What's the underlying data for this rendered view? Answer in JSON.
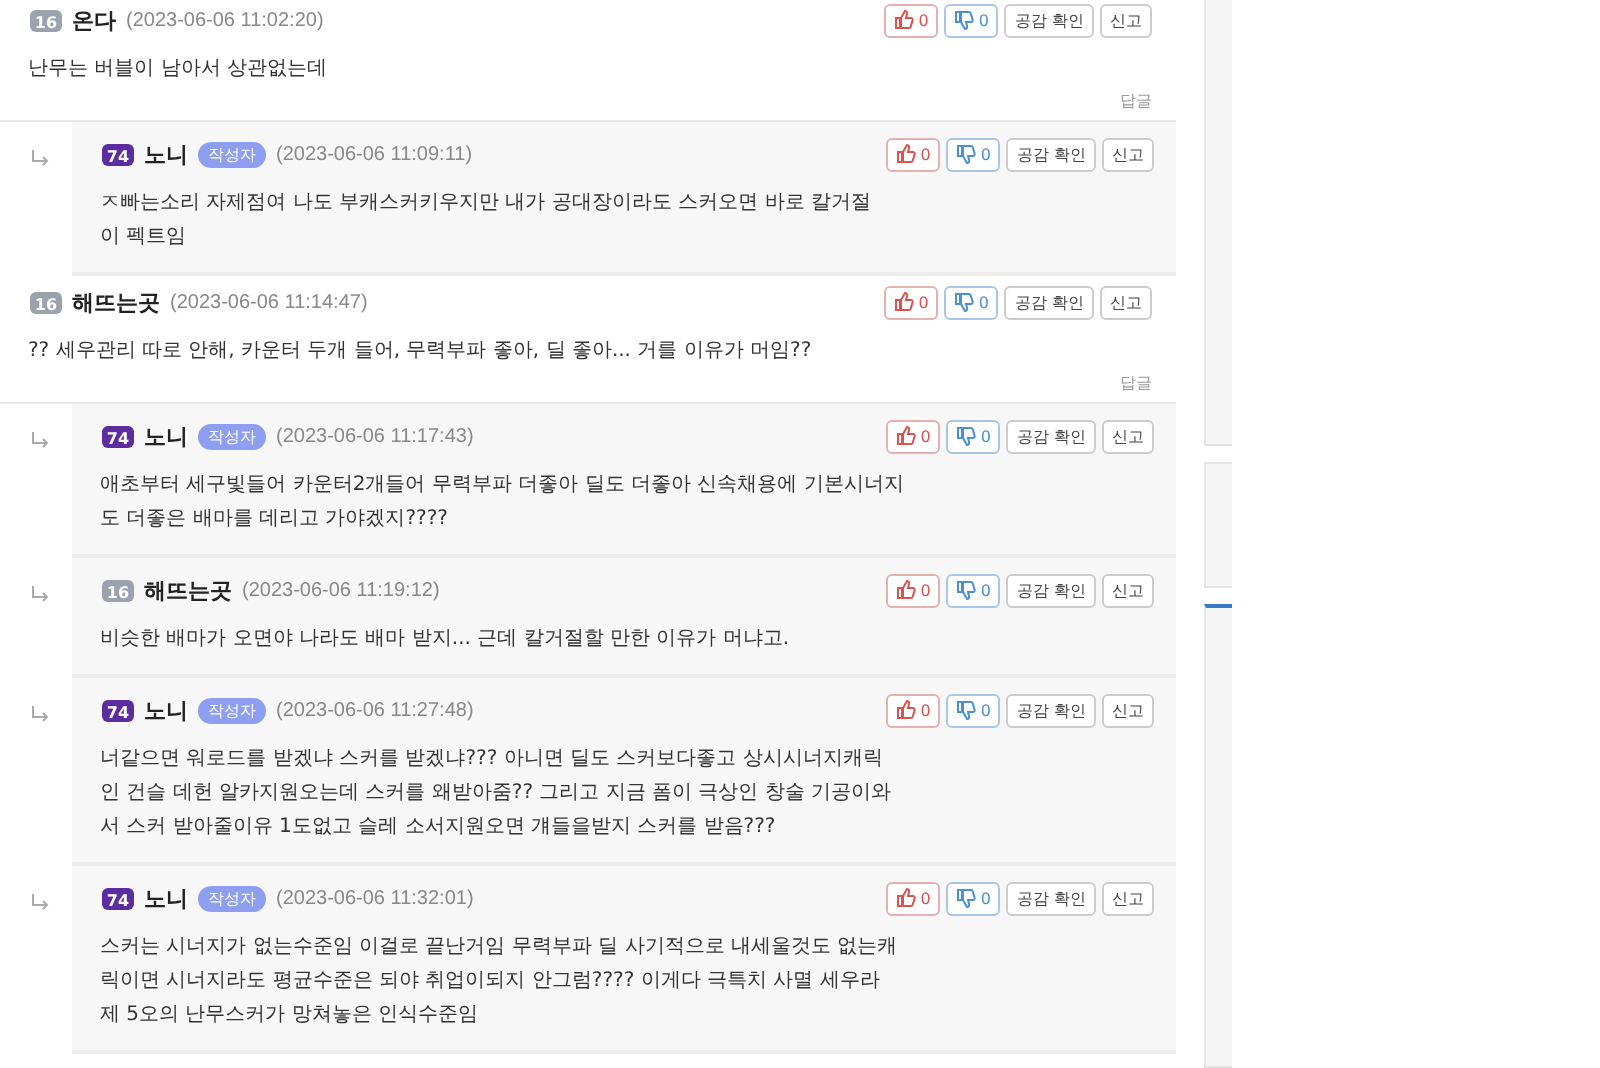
{
  "comments": [
    {
      "kind": "comment",
      "author": "온다",
      "level_badge": "16",
      "color": "#9aa3ad",
      "is_writer": false,
      "time": "(2023-06-06 11:02:20)",
      "text": "난무는 버블이 남아서 상관없는데",
      "likes": "0",
      "dislikes": "0",
      "confirm_label": "공감 확인",
      "report_label": "신고",
      "reply_label": "답글"
    },
    {
      "kind": "reply",
      "author": "노니",
      "level_badge": "74",
      "color": "#5b2d9e",
      "is_writer": true,
      "writer_label": "작성자",
      "time": "(2023-06-06 11:09:11)",
      "text": "ㅈ빠는소리 자제점여 나도 부캐스커키우지만 내가 공대장이라도 스커오면 바로 칼거절\n이 펙트임",
      "likes": "0",
      "dislikes": "0",
      "confirm_label": "공감 확인",
      "report_label": "신고"
    },
    {
      "kind": "comment",
      "author": "해뜨는곳",
      "level_badge": "16",
      "color": "#9aa3ad",
      "is_writer": false,
      "time": "(2023-06-06 11:14:47)",
      "text": "?? 세우관리 따로 안해, 카운터 두개 들어, 무력부파 좋아, 딜 좋아... 거를 이유가 머임??",
      "likes": "0",
      "dislikes": "0",
      "confirm_label": "공감 확인",
      "report_label": "신고",
      "reply_label": "답글"
    },
    {
      "kind": "reply",
      "author": "노니",
      "level_badge": "74",
      "color": "#5b2d9e",
      "is_writer": true,
      "writer_label": "작성자",
      "time": "(2023-06-06 11:17:43)",
      "text": "애초부터 세구빛들어 카운터2개들어 무력부파 더좋아 딜도 더좋아 신속채용에 기본시너지\n도 더좋은 배마를 데리고 가야겠지????",
      "likes": "0",
      "dislikes": "0",
      "confirm_label": "공감 확인",
      "report_label": "신고"
    },
    {
      "kind": "reply",
      "author": "해뜨는곳",
      "level_badge": "16",
      "color": "#9aa3ad",
      "is_writer": false,
      "time": "(2023-06-06 11:19:12)",
      "text": "비슷한 배마가 오면야 나라도 배마 받지... 근데 칼거절할 만한 이유가 머냐고.",
      "likes": "0",
      "dislikes": "0",
      "confirm_label": "공감 확인",
      "report_label": "신고"
    },
    {
      "kind": "reply",
      "author": "노니",
      "level_badge": "74",
      "color": "#5b2d9e",
      "is_writer": true,
      "writer_label": "작성자",
      "time": "(2023-06-06 11:27:48)",
      "text": "너같으면 워로드를 받겠냐 스커를 받겠냐??? 아니면 딜도 스커보다좋고 상시시너지캐릭\n인 건슬 데헌 알카지원오는데 스커를 왜받아줌?? 그리고 지금 폼이 극상인 창술 기공이와\n서 스커 받아줄이유 1도없고 슬레 소서지원오면 걔들을받지 스커를 받음???",
      "likes": "0",
      "dislikes": "0",
      "confirm_label": "공감 확인",
      "report_label": "신고"
    },
    {
      "kind": "reply",
      "author": "노니",
      "level_badge": "74",
      "color": "#5b2d9e",
      "is_writer": true,
      "writer_label": "작성자",
      "time": "(2023-06-06 11:32:01)",
      "text": "스커는 시너지가 없는수준임 이걸로 끝난거임 무력부파 딜 사기적으로 내세울것도 없는캐\n릭이면 시너지라도 평균수준은 되야 취업이되지 안그럼???? 이게다 극특치 사멸 세우라\n제 5오의 난무스커가 망쳐놓은 인식수준임",
      "likes": "0",
      "dislikes": "0",
      "confirm_label": "공감 확인",
      "report_label": "신고"
    }
  ]
}
